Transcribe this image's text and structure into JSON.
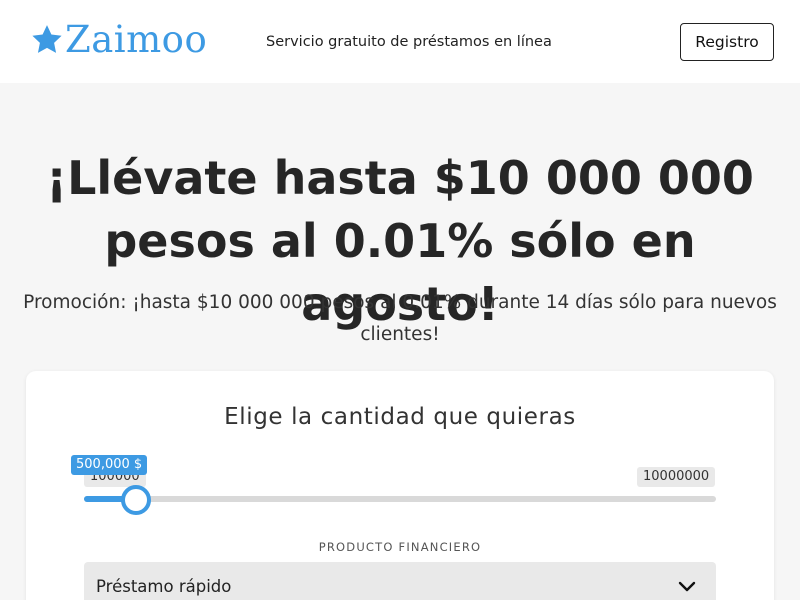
{
  "header": {
    "logo_text": "Zaimoo",
    "logo_icon": "star-icon",
    "tagline": "Servicio gratuito de préstamos en línea",
    "register_label": "Registro"
  },
  "hero": {
    "title_line1": "¡Llévate hasta $10 000 000",
    "title_line2": "pesos al 0.01% sólo en agosto!",
    "subtitle_line1": "Promoción: ¡hasta $10 000 000 pesos al 0.01% durante 14 días sólo para nuevos",
    "subtitle_line2": "clientes!"
  },
  "calculator": {
    "title": "Elige la cantidad que quieras",
    "slider": {
      "min_label": "100000",
      "max_label": "10000000",
      "min": 100000,
      "max": 10000000,
      "value": 500000,
      "value_label": "500,000 $"
    },
    "product_label": "PRODUCTO FINANCIERO",
    "product_value": "Préstamo rápido",
    "product_icon": "chevron-down-icon"
  },
  "colors": {
    "accent": "#3d9ae3",
    "background": "#f6f6f6",
    "text": "#262626"
  }
}
